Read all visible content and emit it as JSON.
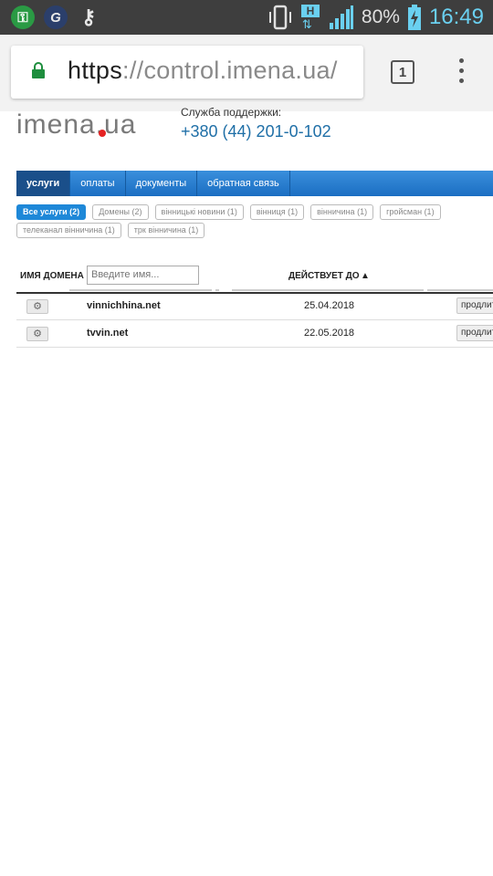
{
  "status_bar": {
    "battery": "80%",
    "time": "16:49",
    "network": "H"
  },
  "browser": {
    "url_scheme": "https",
    "url_rest": "://control.imena.ua/",
    "tab_count": "1"
  },
  "header": {
    "logo_text": "imena.ua",
    "support_label": "Служба поддержки:",
    "phone": "+380 (44) 201-0-102"
  },
  "nav": {
    "items": [
      {
        "label": "услуги",
        "active": true
      },
      {
        "label": "оплаты"
      },
      {
        "label": "документы"
      },
      {
        "label": "обратная связь"
      }
    ]
  },
  "tags": [
    {
      "label": "Все услуги (2)",
      "active": true
    },
    {
      "label": "Домены (2)"
    },
    {
      "label": "вінницькі новини (1)"
    },
    {
      "label": "вінниця (1)"
    },
    {
      "label": "вінничина (1)"
    },
    {
      "label": "гройсман (1)"
    },
    {
      "label": "телеканал вінничина (1)"
    },
    {
      "label": "трк вінничина (1)"
    }
  ],
  "table": {
    "col_name": "ИМЯ ДОМЕНА",
    "filter_placeholder": "Введите имя...",
    "col_valid": "ДЕЙСТВУЕТ ДО",
    "sort_arrow": "▲",
    "rows": [
      {
        "domain": "vinnichhina.net",
        "date": "25.04.2018",
        "action": "продлить"
      },
      {
        "domain": "tvvin.net",
        "date": "22.05.2018",
        "action": "продлить"
      }
    ]
  }
}
